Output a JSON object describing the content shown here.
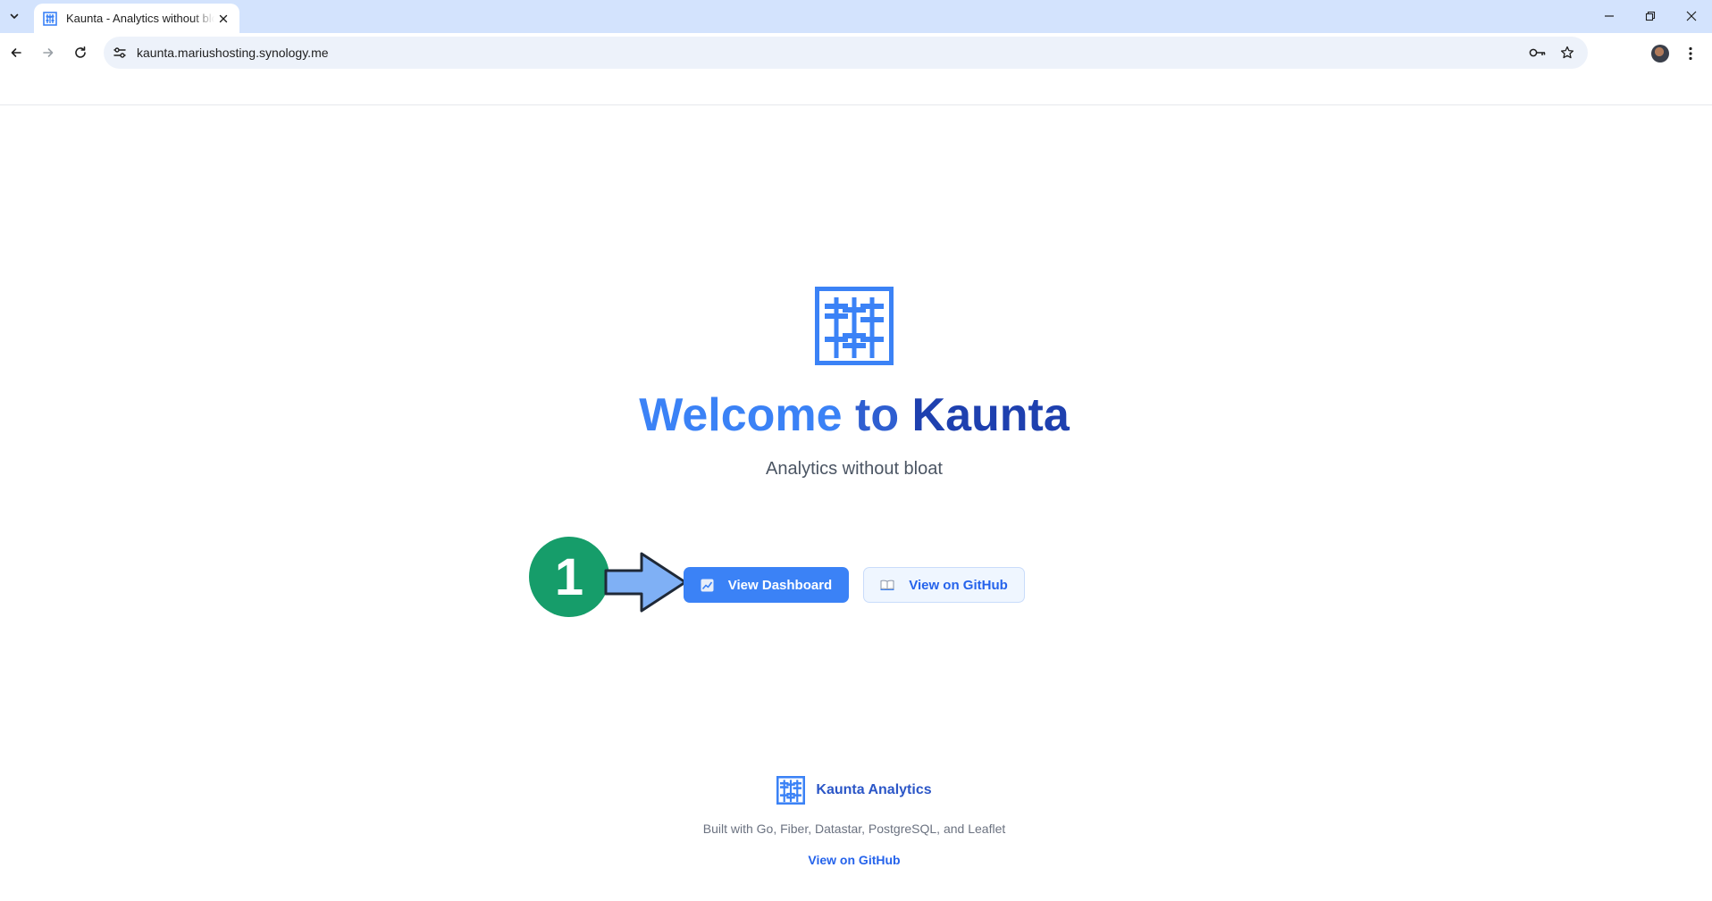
{
  "browser": {
    "tab_title": "Kaunta - Analytics without bloat",
    "url": "kaunta.mariushosting.synology.me"
  },
  "hero": {
    "title_word1": "Welcome",
    "title_word2": "to",
    "title_word3": "Kaunta",
    "subtitle": "Analytics without bloat",
    "primary_button": "View Dashboard",
    "secondary_button": "View on GitHub"
  },
  "annotation": {
    "step_number": "1"
  },
  "footer": {
    "brand": "Kaunta Analytics",
    "credit": "Built with Go, Fiber, Datastar, PostgreSQL, and Leaflet",
    "link": "View on GitHub"
  },
  "colors": {
    "brand_blue": "#3b82f6",
    "brand_dark": "#1e40af",
    "annotation_green": "#169d6a",
    "annotation_arrow": "#7fb0f5"
  },
  "icons": {
    "dashboard_button": "chart-icon",
    "github_button": "book-icon"
  }
}
